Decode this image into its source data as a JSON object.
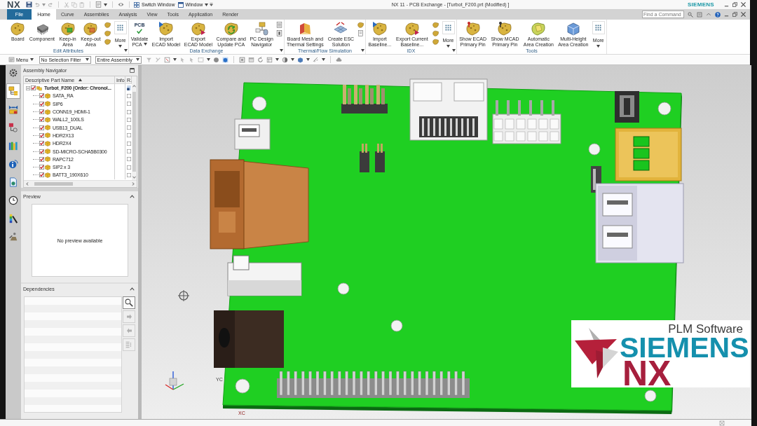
{
  "title_bar": {
    "app_logo": "NX",
    "switch_window": "Switch Window",
    "window_menu": "Window",
    "title": "NX 11 - PCB Exchange - [Turbot_F200.prt (Modified) ]",
    "brand": "SIEMENS"
  },
  "tabs": [
    {
      "label": "File",
      "kind": "file",
      "selected": false
    },
    {
      "label": "Home",
      "kind": "tab",
      "selected": true
    },
    {
      "label": "Curve",
      "kind": "tab",
      "selected": false
    },
    {
      "label": "Assemblies",
      "kind": "tab",
      "selected": false
    },
    {
      "label": "Analysis",
      "kind": "tab",
      "selected": false
    },
    {
      "label": "View",
      "kind": "tab",
      "selected": false
    },
    {
      "label": "Tools",
      "kind": "tab",
      "selected": false
    },
    {
      "label": "Application",
      "kind": "tab",
      "selected": false
    },
    {
      "label": "Render",
      "kind": "tab",
      "selected": false
    }
  ],
  "command_finder": {
    "placeholder": "Find a Command"
  },
  "ribbon": [
    {
      "title": "Edit Attributes",
      "launcher": true,
      "commands": [
        {
          "kind": "large",
          "lines": [
            "Board"
          ],
          "dropdown": false
        },
        {
          "kind": "large",
          "lines": [
            "Component"
          ],
          "dropdown": false
        },
        {
          "kind": "large",
          "lines": [
            "Keep-in",
            "Area"
          ],
          "dropdown": false
        },
        {
          "kind": "large",
          "lines": [
            "Keep-out",
            "Area"
          ],
          "dropdown": false
        },
        {
          "kind": "stack"
        },
        {
          "kind": "more",
          "lines": [
            "More"
          ],
          "dropdown": true
        }
      ]
    },
    {
      "title": "Data Exchange",
      "launcher": true,
      "commands": [
        {
          "kind": "large",
          "icon_text": "PCB",
          "lines": [
            "Validate",
            "PCA"
          ],
          "dropdown": true
        },
        {
          "kind": "large",
          "lines": [
            "Import",
            "ECAD Model"
          ],
          "dropdown": false
        },
        {
          "kind": "large",
          "lines": [
            "Export",
            "ECAD Model"
          ],
          "dropdown": false
        },
        {
          "kind": "large",
          "lines": [
            "Compare and",
            "Update PCA"
          ],
          "dropdown": false
        },
        {
          "kind": "large",
          "lines": [
            "PC Design",
            "Navigator"
          ],
          "dropdown": false
        },
        {
          "kind": "stack"
        }
      ]
    },
    {
      "title": "Thermal/Flow Simulation",
      "launcher": true,
      "commands": [
        {
          "kind": "large",
          "lines": [
            "Board Mesh and",
            "Thermal Settings"
          ],
          "dropdown": false
        },
        {
          "kind": "large",
          "lines": [
            "Create ESC",
            "Solution"
          ],
          "dropdown": false
        },
        {
          "kind": "stack"
        }
      ]
    },
    {
      "title": "IDX",
      "launcher": true,
      "commands": [
        {
          "kind": "large",
          "lines": [
            "Import",
            "Baseline..."
          ],
          "dropdown": false
        },
        {
          "kind": "large",
          "lines": [
            "Export Current",
            "Baseline..."
          ],
          "dropdown": false
        },
        {
          "kind": "stack"
        },
        {
          "kind": "more",
          "lines": [
            "More"
          ],
          "dropdown": true
        }
      ]
    },
    {
      "title": "Tools",
      "launcher": false,
      "commands": [
        {
          "kind": "large",
          "lines": [
            "Show ECAD",
            "Primary Pin"
          ],
          "dropdown": false
        },
        {
          "kind": "large",
          "lines": [
            "Show MCAD",
            "Primary Pin"
          ],
          "dropdown": false
        },
        {
          "kind": "large",
          "lines": [
            "Automatic",
            "Area Creation"
          ],
          "dropdown": false
        },
        {
          "kind": "large",
          "lines": [
            "Multi-Height",
            "Area Creation"
          ],
          "dropdown": false
        },
        {
          "kind": "more",
          "lines": [
            "More"
          ],
          "dropdown": true
        }
      ]
    }
  ],
  "toolbar": {
    "menu": "Menu",
    "selection_filter": "No Selection Filter",
    "scope": "Entire Assembly"
  },
  "resource_bar": [
    {
      "selected": false
    },
    {
      "selected": true
    },
    {
      "selected": false
    },
    {
      "selected": false
    },
    {
      "selected": false
    },
    {
      "selected": false
    },
    {
      "selected": false
    },
    {
      "selected": false
    },
    {
      "selected": false
    },
    {
      "selected": false
    }
  ],
  "assembly_navigator": {
    "title": "Assembly Navigator",
    "columns": [
      "Descriptive Part Name",
      "Info",
      "R."
    ],
    "parts": [
      {
        "name": "Turbot_F200 (Order: Chronol...",
        "checked": true,
        "expanded": true,
        "children": [
          {
            "name": "SATA_RA",
            "checked": true,
            "r_checked": false
          },
          {
            "name": "SIP6",
            "checked": true,
            "r_checked": false
          },
          {
            "name": "CONN19_HDMI-1",
            "checked": true,
            "r_checked": false
          },
          {
            "name": "WALL2_100LS",
            "checked": true,
            "r_checked": false
          },
          {
            "name": "USB13_DUAL",
            "checked": true,
            "r_checked": false
          },
          {
            "name": "HDR2X13",
            "checked": true,
            "r_checked": false
          },
          {
            "name": "HDR2X4",
            "checked": true,
            "r_checked": false
          },
          {
            "name": "SD-MICRO-SCHA5B0300",
            "checked": true,
            "r_checked": false
          },
          {
            "name": "RAPC712",
            "checked": true,
            "r_checked": false
          },
          {
            "name": "SIP2 x 3",
            "checked": true,
            "r_checked": false
          },
          {
            "name": "BATT3_190X610",
            "checked": true,
            "r_checked": false
          }
        ]
      }
    ]
  },
  "preview": {
    "title": "Preview",
    "expanded": true,
    "message": "No preview available"
  },
  "dependencies": {
    "title": "Dependencies",
    "expanded": true
  },
  "viewport": {
    "axis_labels": [
      "YC",
      "XC"
    ]
  },
  "logo": {
    "tagline": "PLM Software",
    "wordmark": "SIEMENS",
    "product": "NX"
  }
}
